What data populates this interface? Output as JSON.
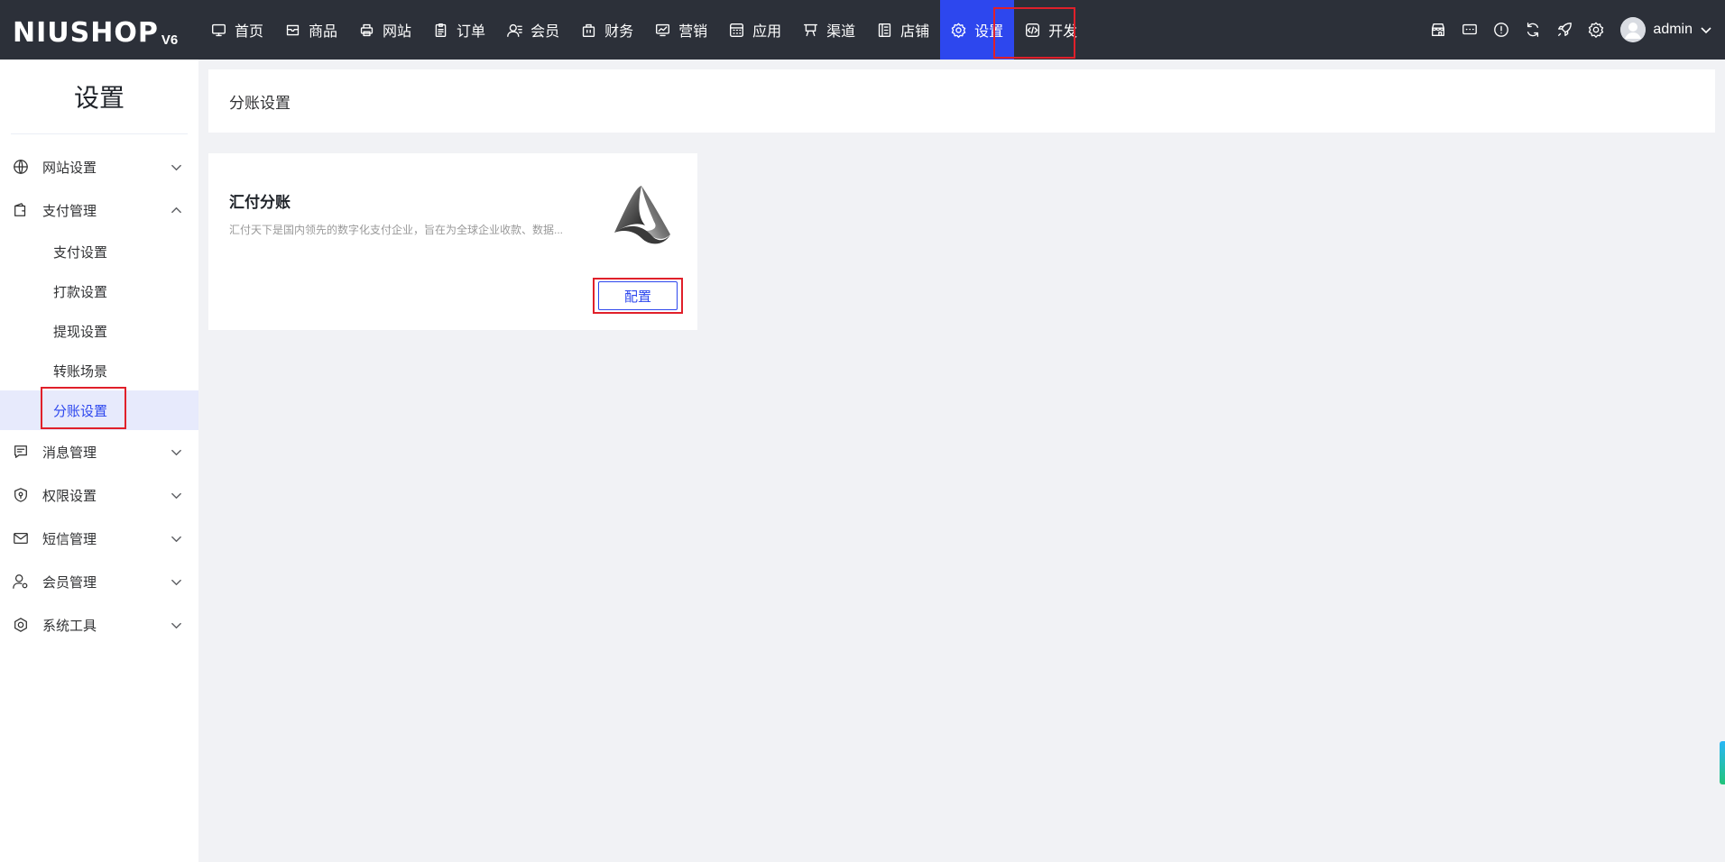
{
  "brand": {
    "name": "NIUSHOP",
    "version": "V6"
  },
  "nav": {
    "items": [
      {
        "label": "首页",
        "icon": "monitor-icon",
        "name": "nav-home"
      },
      {
        "label": "商品",
        "icon": "box-icon",
        "name": "nav-goods"
      },
      {
        "label": "网站",
        "icon": "printer-icon",
        "name": "nav-site"
      },
      {
        "label": "订单",
        "icon": "clipboard-icon",
        "name": "nav-order"
      },
      {
        "label": "会员",
        "icon": "user-icon",
        "name": "nav-member"
      },
      {
        "label": "财务",
        "icon": "bag-icon",
        "name": "nav-finance"
      },
      {
        "label": "营销",
        "icon": "chart-icon",
        "name": "nav-marketing"
      },
      {
        "label": "应用",
        "icon": "grid-icon",
        "name": "nav-apps"
      },
      {
        "label": "渠道",
        "icon": "flag-icon",
        "name": "nav-channel"
      },
      {
        "label": "店铺",
        "icon": "list-icon",
        "name": "nav-store"
      },
      {
        "label": "设置",
        "icon": "gear-icon",
        "name": "nav-settings",
        "active": true
      },
      {
        "label": "开发",
        "icon": "code-icon",
        "name": "nav-develop"
      }
    ]
  },
  "user": {
    "name": "admin"
  },
  "sidebar": {
    "title": "设置",
    "groups": [
      {
        "label": "网站设置",
        "icon": "globe-icon",
        "expanded": false
      },
      {
        "label": "支付管理",
        "icon": "wallet-icon",
        "expanded": true,
        "children": [
          {
            "label": "支付设置"
          },
          {
            "label": "打款设置"
          },
          {
            "label": "提现设置"
          },
          {
            "label": "转账场景"
          },
          {
            "label": "分账设置",
            "active": true
          }
        ]
      },
      {
        "label": "消息管理",
        "icon": "message-icon",
        "expanded": false
      },
      {
        "label": "权限设置",
        "icon": "shield-icon",
        "expanded": false
      },
      {
        "label": "短信管理",
        "icon": "mail-icon",
        "expanded": false
      },
      {
        "label": "会员管理",
        "icon": "user-gear-icon",
        "expanded": false
      },
      {
        "label": "系统工具",
        "icon": "hexagon-gear-icon",
        "expanded": false
      }
    ]
  },
  "page": {
    "title": "分账设置"
  },
  "card": {
    "title": "汇付分账",
    "description": "汇付天下是国内领先的数字化支付企业，旨在为全球企业收款、数据...",
    "button": "配置"
  },
  "colors": {
    "topbar": "#2c3039",
    "accent": "#2d47ee",
    "highlight": "#e0202a"
  }
}
